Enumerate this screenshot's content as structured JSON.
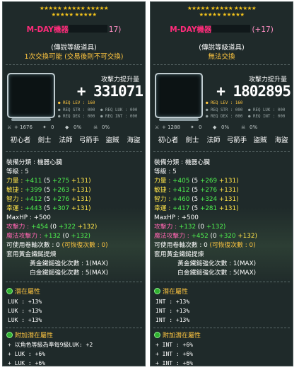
{
  "panels": [
    {
      "stars": "★★★★★ ★★★★★ ★★★★★\n★★★★★ ★★★★★",
      "name": "M-DAY機器",
      "name_suffix": "17)",
      "grade": "(傳說等級道具)",
      "note": "1次交換可能 (交易後則不可交換)",
      "attack_label": "攻擊力提升量",
      "attack_value": "+ 331071",
      "req": {
        "lev": "● REQ LEV : 160",
        "str": "● REQ STR : 000",
        "luk": "● REQ LUK : 000",
        "dex": "● REQ DEX : 000",
        "int": "● REQ INT : 000"
      },
      "icons": {
        "a": "+ 1676",
        "b": "0",
        "c": "0%",
        "d": "0%"
      },
      "jobs": [
        "初心者",
        "劍士",
        "法師",
        "弓箭手",
        "盜賊",
        "海盜"
      ],
      "stats": {
        "type": "裝備分類 : 機器心臟",
        "level": "等級 : 5",
        "str": {
          "label": "力量 :",
          "total": "+411",
          "base": "(5",
          "add": "+275",
          "plus": "+131)"
        },
        "dex": {
          "label": "敏捷 :",
          "total": "+399",
          "base": "(5",
          "add": "+263",
          "plus": "+131)"
        },
        "int": {
          "label": "智力 :",
          "total": "+412",
          "base": "(5",
          "add": "+276",
          "plus": "+131)"
        },
        "luk": {
          "label": "幸運 :",
          "total": "+443",
          "base": "(5",
          "add": "+307",
          "plus": "+131)"
        },
        "maxhp": "MaxHP : +500",
        "atk": {
          "label": "攻擊力 :",
          "total": "+454",
          "base": "(0",
          "add": "+322",
          "plus": "+132)"
        },
        "matk": {
          "label": "魔法攻擊力 :",
          "total": "+132",
          "base": "(0",
          "add": "+132)"
        },
        "upgrades": "可使用卷軸次數 : 0 ",
        "recover": "(可恢復次數 : 0)",
        "hammer": "套用黃金鐵鎚提煉",
        "hammer1": "黃金鐵鎚強化次數 : 1(MAX)",
        "hammer2": "白金鐵鎚強化次數 : 5(MAX)"
      },
      "potential_title": "潛在屬性",
      "potential": [
        "LUK : +13%",
        "LUK : +13%",
        "LUK : +13%"
      ],
      "bonus_title": "附加潛在屬性",
      "bonus": [
        "+ 以角色等級為準每9級LUK: +2",
        "+ LUK : +6%",
        "+ LUK : +6%"
      ]
    },
    {
      "stars": "★★★★★ ★★★★★ ★★★★★\n★★★★★ ★★★★★",
      "name": "M-DAY機器",
      "name_suffix": "(+17)",
      "grade": "(傳說等級道具)",
      "note": "無法交換",
      "attack_label": "攻擊力提升量",
      "attack_value": "+ 1802895",
      "req": {
        "lev": "● REQ LEV : 160",
        "str": "● REQ STR : 000",
        "luk": "● REQ LUK : 000",
        "dex": "● REQ DEX : 000",
        "int": "● REQ INT : 000"
      },
      "icons": {
        "a": "+ 1288",
        "b": "0",
        "c": "0%",
        "d": "0%"
      },
      "jobs": [
        "初心者",
        "劍士",
        "法師",
        "弓箭手",
        "盜賊",
        "海盜"
      ],
      "stats": {
        "type": "裝備分類 : 機器心臟",
        "level": "等級 : 5",
        "str": {
          "label": "力量 :",
          "total": "+405",
          "base": "(5",
          "add": "+269",
          "plus": "+131)"
        },
        "dex": {
          "label": "敏捷 :",
          "total": "+412",
          "base": "(5",
          "add": "+276",
          "plus": "+131)"
        },
        "int": {
          "label": "智力 :",
          "total": "+460",
          "base": "(5",
          "add": "+324",
          "plus": "+131)"
        },
        "luk": {
          "label": "幸運 :",
          "total": "+417",
          "base": "(5",
          "add": "+281",
          "plus": "+131)"
        },
        "maxhp": "MaxHP : +500",
        "atk": {
          "label": "攻擊力 :",
          "total": "+132",
          "base": "(0",
          "add": "+132)"
        },
        "matk": {
          "label": "魔法攻擊力 :",
          "total": "+452",
          "base": "(0",
          "add": "+320",
          "plus": "+132)"
        },
        "upgrades": "可使用卷軸次數 : 0 ",
        "recover": "(可恢復次數 : 0)",
        "hammer": "套用黃金鐵鎚提煉",
        "hammer1": "黃金鐵鎚強化次數 : 1(MAX)",
        "hammer2": "白金鐵鎚強化次數 : 5(MAX)"
      },
      "potential_title": "潛在屬性",
      "potential": [
        "INT : +13%",
        "INT : +13%",
        "INT : +13%"
      ],
      "bonus_title": "附加潛在屬性",
      "bonus": [
        "+ INT : +6%",
        "+ INT : +6%",
        "+ INT : +6%"
      ]
    }
  ]
}
